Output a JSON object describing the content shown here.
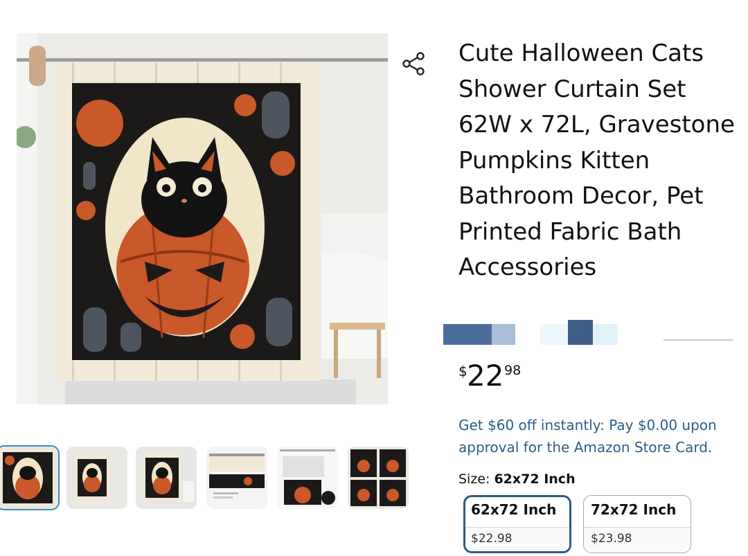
{
  "product": {
    "title": "Cute Halloween Cats Shower Curtain Set 62W x 72L, Gravestone Pumpkins Kitten Bathroom Decor, Pet Printed Fabric Bath Accessories",
    "price_symbol": "$",
    "price_whole": "22",
    "price_fraction": "98",
    "promo": "Get $60 off instantly: Pay $0.00 upon approval for the Amazon Store Card.",
    "size_prefix": "Size: ",
    "size_selected": "62x72 Inch"
  },
  "sizes": [
    {
      "label": "62x72 Inch",
      "price": "$22.98",
      "selected": true
    },
    {
      "label": "72x72 Inch",
      "price": "$23.98",
      "selected": false
    }
  ],
  "icons": {
    "share": "share-icon"
  },
  "colors": {
    "accent_blue": "#2d5d8b",
    "selected_border": "#2e5a83",
    "thumb_active": "#3b88c7",
    "pumpkin": "#c9582a"
  }
}
